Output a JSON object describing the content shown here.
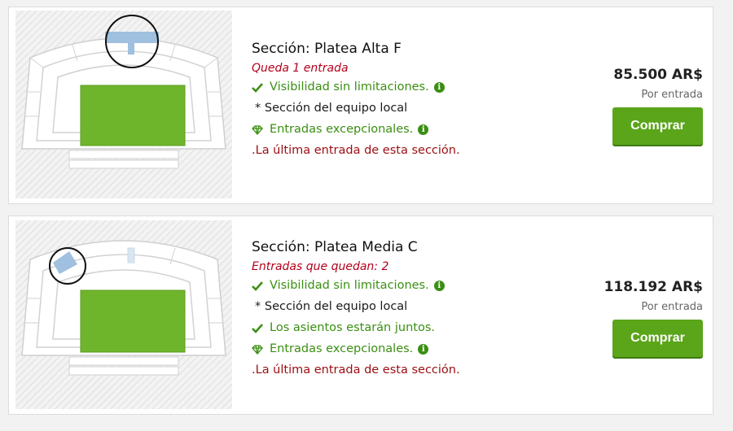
{
  "listings": [
    {
      "section_title": "Sección: Platea Alta F",
      "availability": "Queda 1 entrada",
      "features": [
        {
          "icon": "checkmark-icon",
          "text": "Visibilidad sin limitaciones.",
          "style": "green",
          "has_info": true
        },
        {
          "icon": "asterisk",
          "text": "* Sección del equipo local",
          "style": "dark",
          "has_info": false
        },
        {
          "icon": "diamond-icon",
          "text": "Entradas excepcionales.",
          "style": "green",
          "has_info": true
        }
      ],
      "last_note": ".La última entrada de esta sección.",
      "price": "85.500 AR$",
      "price_unit": "Por entrada",
      "buy_label": "Comprar"
    },
    {
      "section_title": "Sección: Platea Media C",
      "availability": "Entradas que quedan: 2",
      "features": [
        {
          "icon": "checkmark-icon",
          "text": "Visibilidad sin limitaciones.",
          "style": "green",
          "has_info": true
        },
        {
          "icon": "asterisk",
          "text": "* Sección del equipo local",
          "style": "dark",
          "has_info": false
        },
        {
          "icon": "checkmark-icon",
          "text": "Los asientos estarán juntos.",
          "style": "green",
          "has_info": false
        },
        {
          "icon": "diamond-icon",
          "text": "Entradas excepcionales.",
          "style": "green",
          "has_info": true
        }
      ],
      "last_note": ".La última entrada de esta sección.",
      "price": "118.192 AR$",
      "price_unit": "Por entrada",
      "buy_label": "Comprar"
    }
  ],
  "info_glyph": "i",
  "colors": {
    "accent_green": "#5aa51a",
    "feature_green": "#3a8f12",
    "alert_red": "#b3001b",
    "pitch_green": "#6fb52c",
    "highlight_section": "#9fc0de"
  }
}
